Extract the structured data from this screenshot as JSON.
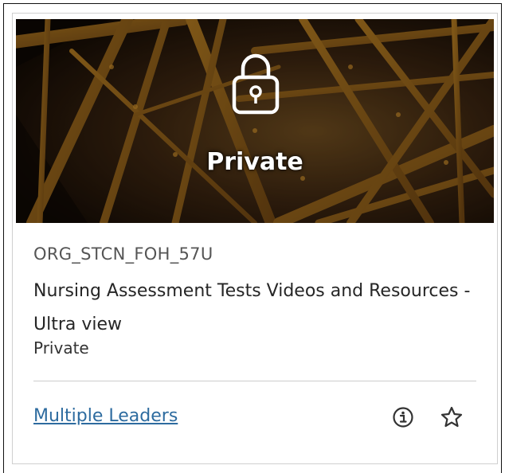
{
  "card": {
    "banner_label": "Private",
    "course_code": "ORG_STCN_FOH_57U",
    "title": "Nursing Assessment Tests Videos and Resources - Ultra view",
    "status": "Private",
    "leaders_link": "Multiple Leaders"
  },
  "icons": {
    "lock": "lock-icon",
    "info": "info-icon",
    "favorite": "star-outline-icon"
  },
  "colors": {
    "link": "#2d6b9f",
    "banner_overlay": "#1a0f06",
    "text_primary": "#262626",
    "text_secondary": "#555555",
    "divider": "#cccccc"
  }
}
